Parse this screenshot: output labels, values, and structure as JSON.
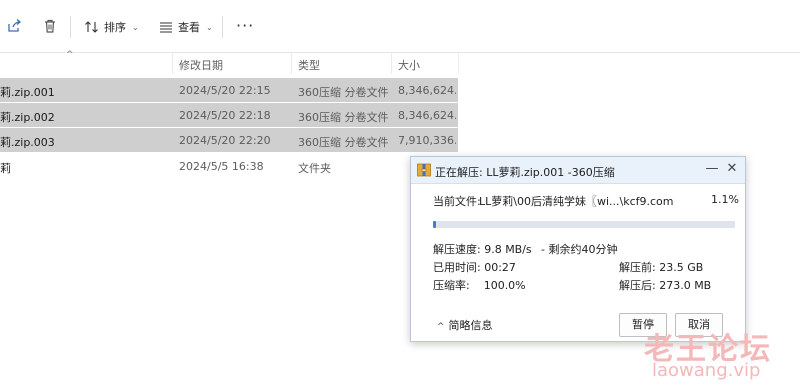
{
  "toolbar": {
    "sort_label": "排序",
    "view_label": "查看",
    "more_label": "···"
  },
  "columns": {
    "date": "修改日期",
    "type": "类型",
    "size": "大小"
  },
  "files": [
    {
      "name": "莉.zip.001",
      "date": "2024/5/20 22:15",
      "type": "360压缩 分卷文件",
      "size": "8,346,624...",
      "selected": true
    },
    {
      "name": "莉.zip.002",
      "date": "2024/5/20 22:18",
      "type": "360压缩 分卷文件",
      "size": "8,346,624...",
      "selected": true
    },
    {
      "name": "莉.zip.003",
      "date": "2024/5/20 22:20",
      "type": "360压缩 分卷文件",
      "size": "7,910,336...",
      "selected": true
    },
    {
      "name": "莉",
      "date": "2024/5/5 16:38",
      "type": "文件夹",
      "size": "",
      "selected": false
    }
  ],
  "dialog": {
    "title": "正在解压: LL萝莉.zip.001 -360压缩",
    "current_file_label": "当前文件:",
    "current_file": "LL萝莉\\00后清纯学妹〖wi...\\kcf9.com",
    "percent_text": "1.1%",
    "progress": 0.011,
    "speed": "解压速度: 9.8 MB/s",
    "remaining": "- 剩余约40分钟",
    "elapsed": "已用时间: 00:27",
    "before": "解压前: 23.5 GB",
    "ratio": "压缩率:    100.0%",
    "after": "解压后: 273.0 MB",
    "summary_label": "简略信息",
    "pause_label": "暂停",
    "cancel_label": "取消",
    "minimize": "—",
    "close": "✕"
  },
  "watermark": {
    "cn": "老王论坛",
    "url": "laowang.vip"
  },
  "colors": {
    "accent": "#3e7fd6",
    "selection": "#cfcfcf",
    "title_bar": "#e9f1fb"
  }
}
